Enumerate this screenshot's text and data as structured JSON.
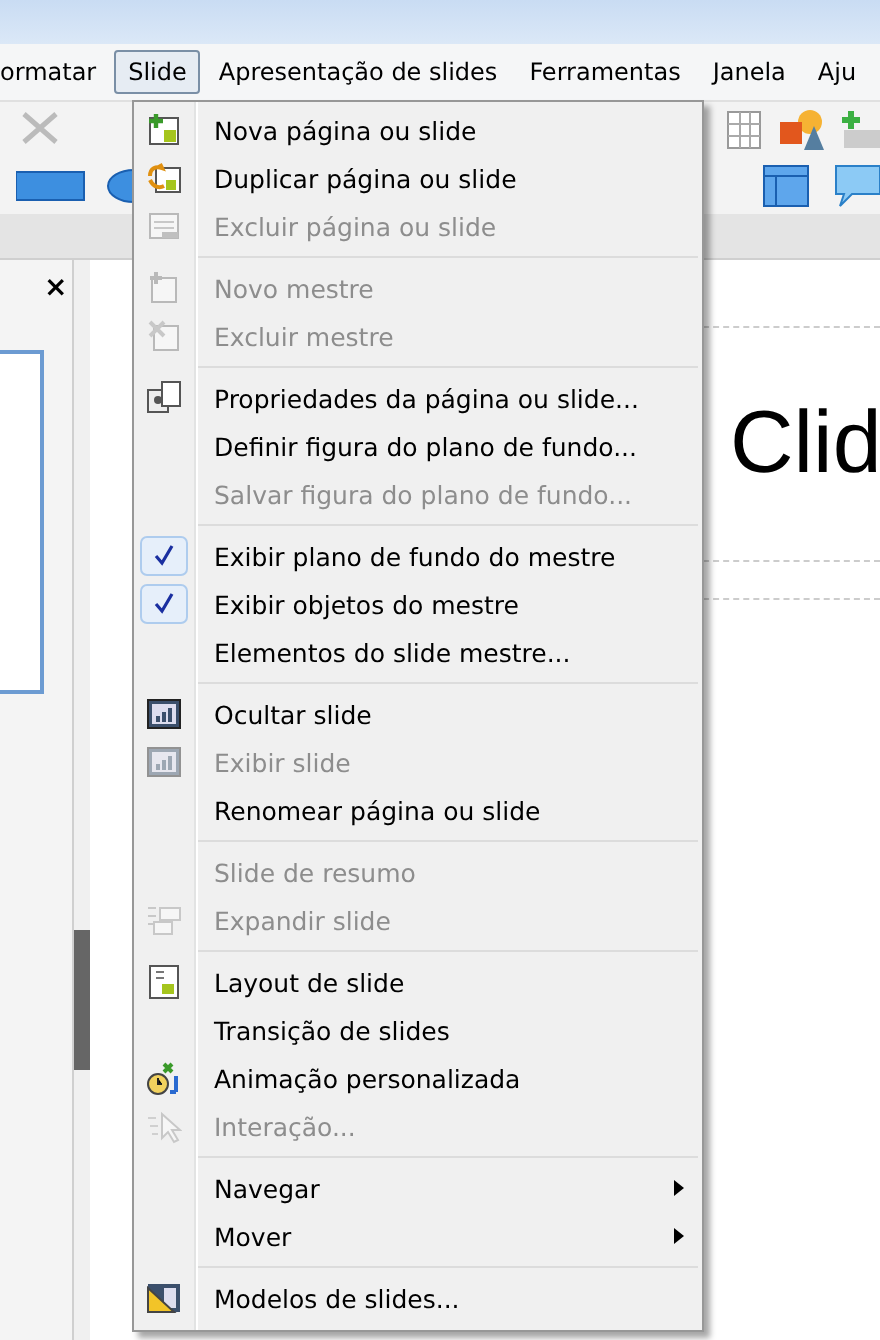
{
  "menubar": [
    {
      "label": "ormatar",
      "selected": false
    },
    {
      "label": "Slide",
      "selected": true
    },
    {
      "label": "Apresentação de slides",
      "selected": false
    },
    {
      "label": "Ferramentas",
      "selected": false
    },
    {
      "label": "Janela",
      "selected": false
    },
    {
      "label": "Aju",
      "selected": false
    }
  ],
  "panel": {
    "close": "×"
  },
  "slide": {
    "title": "Clid"
  },
  "menu": [
    [
      {
        "label": "Nova página ou slide",
        "disabled": false,
        "kind": "new"
      },
      {
        "label": "Duplicar página ou slide",
        "disabled": false,
        "kind": "duplicate"
      },
      {
        "label": "Excluir página ou slide",
        "disabled": true,
        "kind": "delete"
      }
    ],
    [
      {
        "label": "Novo mestre",
        "disabled": true,
        "kind": "master"
      },
      {
        "label": "Excluir mestre",
        "disabled": true,
        "kind": "delmaster"
      }
    ],
    [
      {
        "label": "Propriedades da página ou slide...",
        "disabled": false,
        "kind": "properties"
      },
      {
        "label": "Definir figura do plano de fundo...",
        "disabled": false
      },
      {
        "label": "Salvar figura do plano de fundo...",
        "disabled": true
      }
    ],
    [
      {
        "label": "Exibir plano de fundo do mestre",
        "disabled": false,
        "checked": true
      },
      {
        "label": "Exibir objetos do mestre",
        "disabled": false,
        "checked": true
      },
      {
        "label": "Elementos do slide mestre...",
        "disabled": false
      }
    ],
    [
      {
        "label": "Ocultar slide",
        "disabled": false,
        "kind": "chart"
      },
      {
        "label": "Exibir slide",
        "disabled": true,
        "kind": "chart"
      },
      {
        "label": "Renomear página ou slide",
        "disabled": false
      }
    ],
    [
      {
        "label": "Slide de resumo",
        "disabled": true
      },
      {
        "label": "Expandir slide",
        "disabled": true,
        "kind": "expand"
      }
    ],
    [
      {
        "label": "Layout de slide",
        "disabled": false,
        "kind": "layout"
      },
      {
        "label": "Transição de slides",
        "disabled": false
      },
      {
        "label": "Animação personalizada",
        "disabled": false,
        "kind": "animation"
      },
      {
        "label": "Interação...",
        "disabled": true,
        "kind": "interaction"
      }
    ],
    [
      {
        "label": "Navegar",
        "disabled": false,
        "submenu": true
      },
      {
        "label": "Mover",
        "disabled": false,
        "submenu": true
      }
    ],
    [
      {
        "label": "Modelos de slides...",
        "disabled": false,
        "kind": "templates"
      }
    ]
  ]
}
